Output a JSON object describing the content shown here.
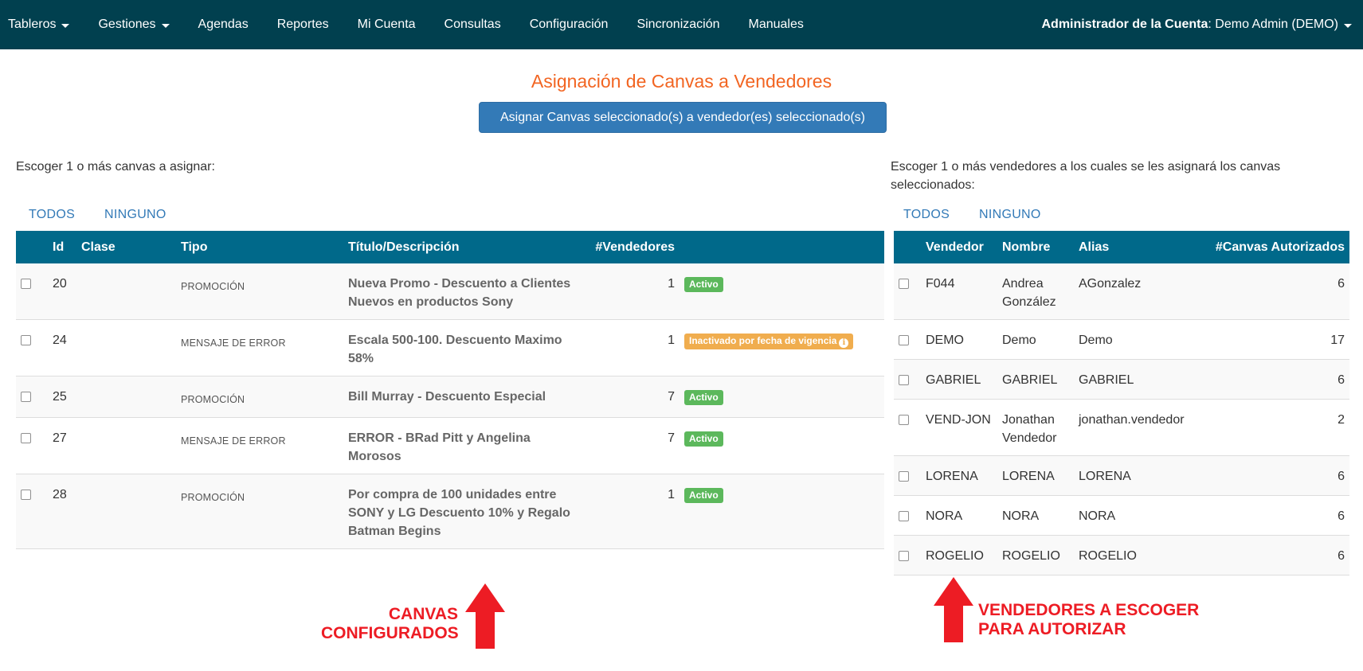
{
  "nav": {
    "items": [
      {
        "label": "Tableros",
        "caret": true
      },
      {
        "label": "Gestiones",
        "caret": true
      },
      {
        "label": "Agendas",
        "caret": false
      },
      {
        "label": "Reportes",
        "caret": false
      },
      {
        "label": "Mi Cuenta",
        "caret": false
      },
      {
        "label": "Consultas",
        "caret": false
      },
      {
        "label": "Configuración",
        "caret": false
      },
      {
        "label": "Sincronización",
        "caret": false
      },
      {
        "label": "Manuales",
        "caret": false
      }
    ],
    "user_label": "Administrador de la Cuenta",
    "user_value": ": Demo Admin (DEMO)"
  },
  "page": {
    "title": "Asignación de Canvas a Vendedores",
    "assign_button": "Asignar Canvas seleccionado(s) a vendedor(es) seleccionado(s)"
  },
  "canvas_section": {
    "instruction": "Escoger 1 o más canvas a asignar:",
    "all_link": "TODOS",
    "none_link": "NINGUNO",
    "columns": [
      "Id",
      "Clase",
      "Tipo",
      "Título/Descripción",
      "#Vendedores"
    ],
    "rows": [
      {
        "id": "20",
        "clase": "",
        "tipo": "PROMOCIÓN",
        "titulo": "Nueva Promo - Descuento a Clientes Nuevos en productos Sony",
        "vendedores": "1",
        "status": "Activo",
        "status_color": "#5cb85c",
        "info": false
      },
      {
        "id": "24",
        "clase": "",
        "tipo": "MENSAJE DE ERROR",
        "titulo": "Escala 500-100. Descuento Maximo 58%",
        "vendedores": "1",
        "status": "Inactivado por fecha de vigencia",
        "status_color": "#f0ad4e",
        "info": true
      },
      {
        "id": "25",
        "clase": "",
        "tipo": "PROMOCIÓN",
        "titulo": "Bill Murray - Descuento Especial",
        "vendedores": "7",
        "status": "Activo",
        "status_color": "#5cb85c",
        "info": false
      },
      {
        "id": "27",
        "clase": "",
        "tipo": "MENSAJE DE ERROR",
        "titulo": "ERROR - BRad Pitt y Angelina Morosos",
        "vendedores": "7",
        "status": "Activo",
        "status_color": "#5cb85c",
        "info": false
      },
      {
        "id": "28",
        "clase": "",
        "tipo": "PROMOCIÓN",
        "titulo": "Por compra de 100 unidades entre SONY y LG Descuento 10% y Regalo Batman Begins",
        "vendedores": "1",
        "status": "Activo",
        "status_color": "#5cb85c",
        "info": false
      }
    ]
  },
  "vendor_section": {
    "instruction": "Escoger 1 o más vendedores a los cuales se les asignará los canvas seleccionados:",
    "all_link": "TODOS",
    "none_link": "NINGUNO",
    "columns": [
      "Vendedor",
      "Nombre",
      "Alias",
      "#Canvas Autorizados"
    ],
    "rows": [
      {
        "vendedor": "F044",
        "nombre": "Andrea González",
        "alias": "AGonzalez",
        "canvas": "6"
      },
      {
        "vendedor": "DEMO",
        "nombre": "Demo",
        "alias": "Demo",
        "canvas": "17"
      },
      {
        "vendedor": "GABRIEL",
        "nombre": "GABRIEL",
        "alias": "GABRIEL",
        "canvas": "6"
      },
      {
        "vendedor": "VEND-JON",
        "nombre": "Jonathan Vendedor",
        "alias": "jonathan.vendedor",
        "canvas": "2"
      },
      {
        "vendedor": "LORENA",
        "nombre": "LORENA",
        "alias": "LORENA",
        "canvas": "6"
      },
      {
        "vendedor": "NORA",
        "nombre": "NORA",
        "alias": "NORA",
        "canvas": "6"
      },
      {
        "vendedor": "ROGELIO",
        "nombre": "ROGELIO",
        "alias": "ROGELIO",
        "canvas": "6"
      }
    ]
  },
  "annotations": {
    "left_line1": "CANVAS",
    "left_line2": "CONFIGURADOS",
    "right_line1": "VENDEDORES A ESCOGER",
    "right_line2": "PARA AUTORIZAR",
    "color": "#ed1c24"
  },
  "colors": {
    "navbar": "#01404f",
    "table_header": "#00698a",
    "primary_button": "#337ab7",
    "title": "#f26522"
  }
}
